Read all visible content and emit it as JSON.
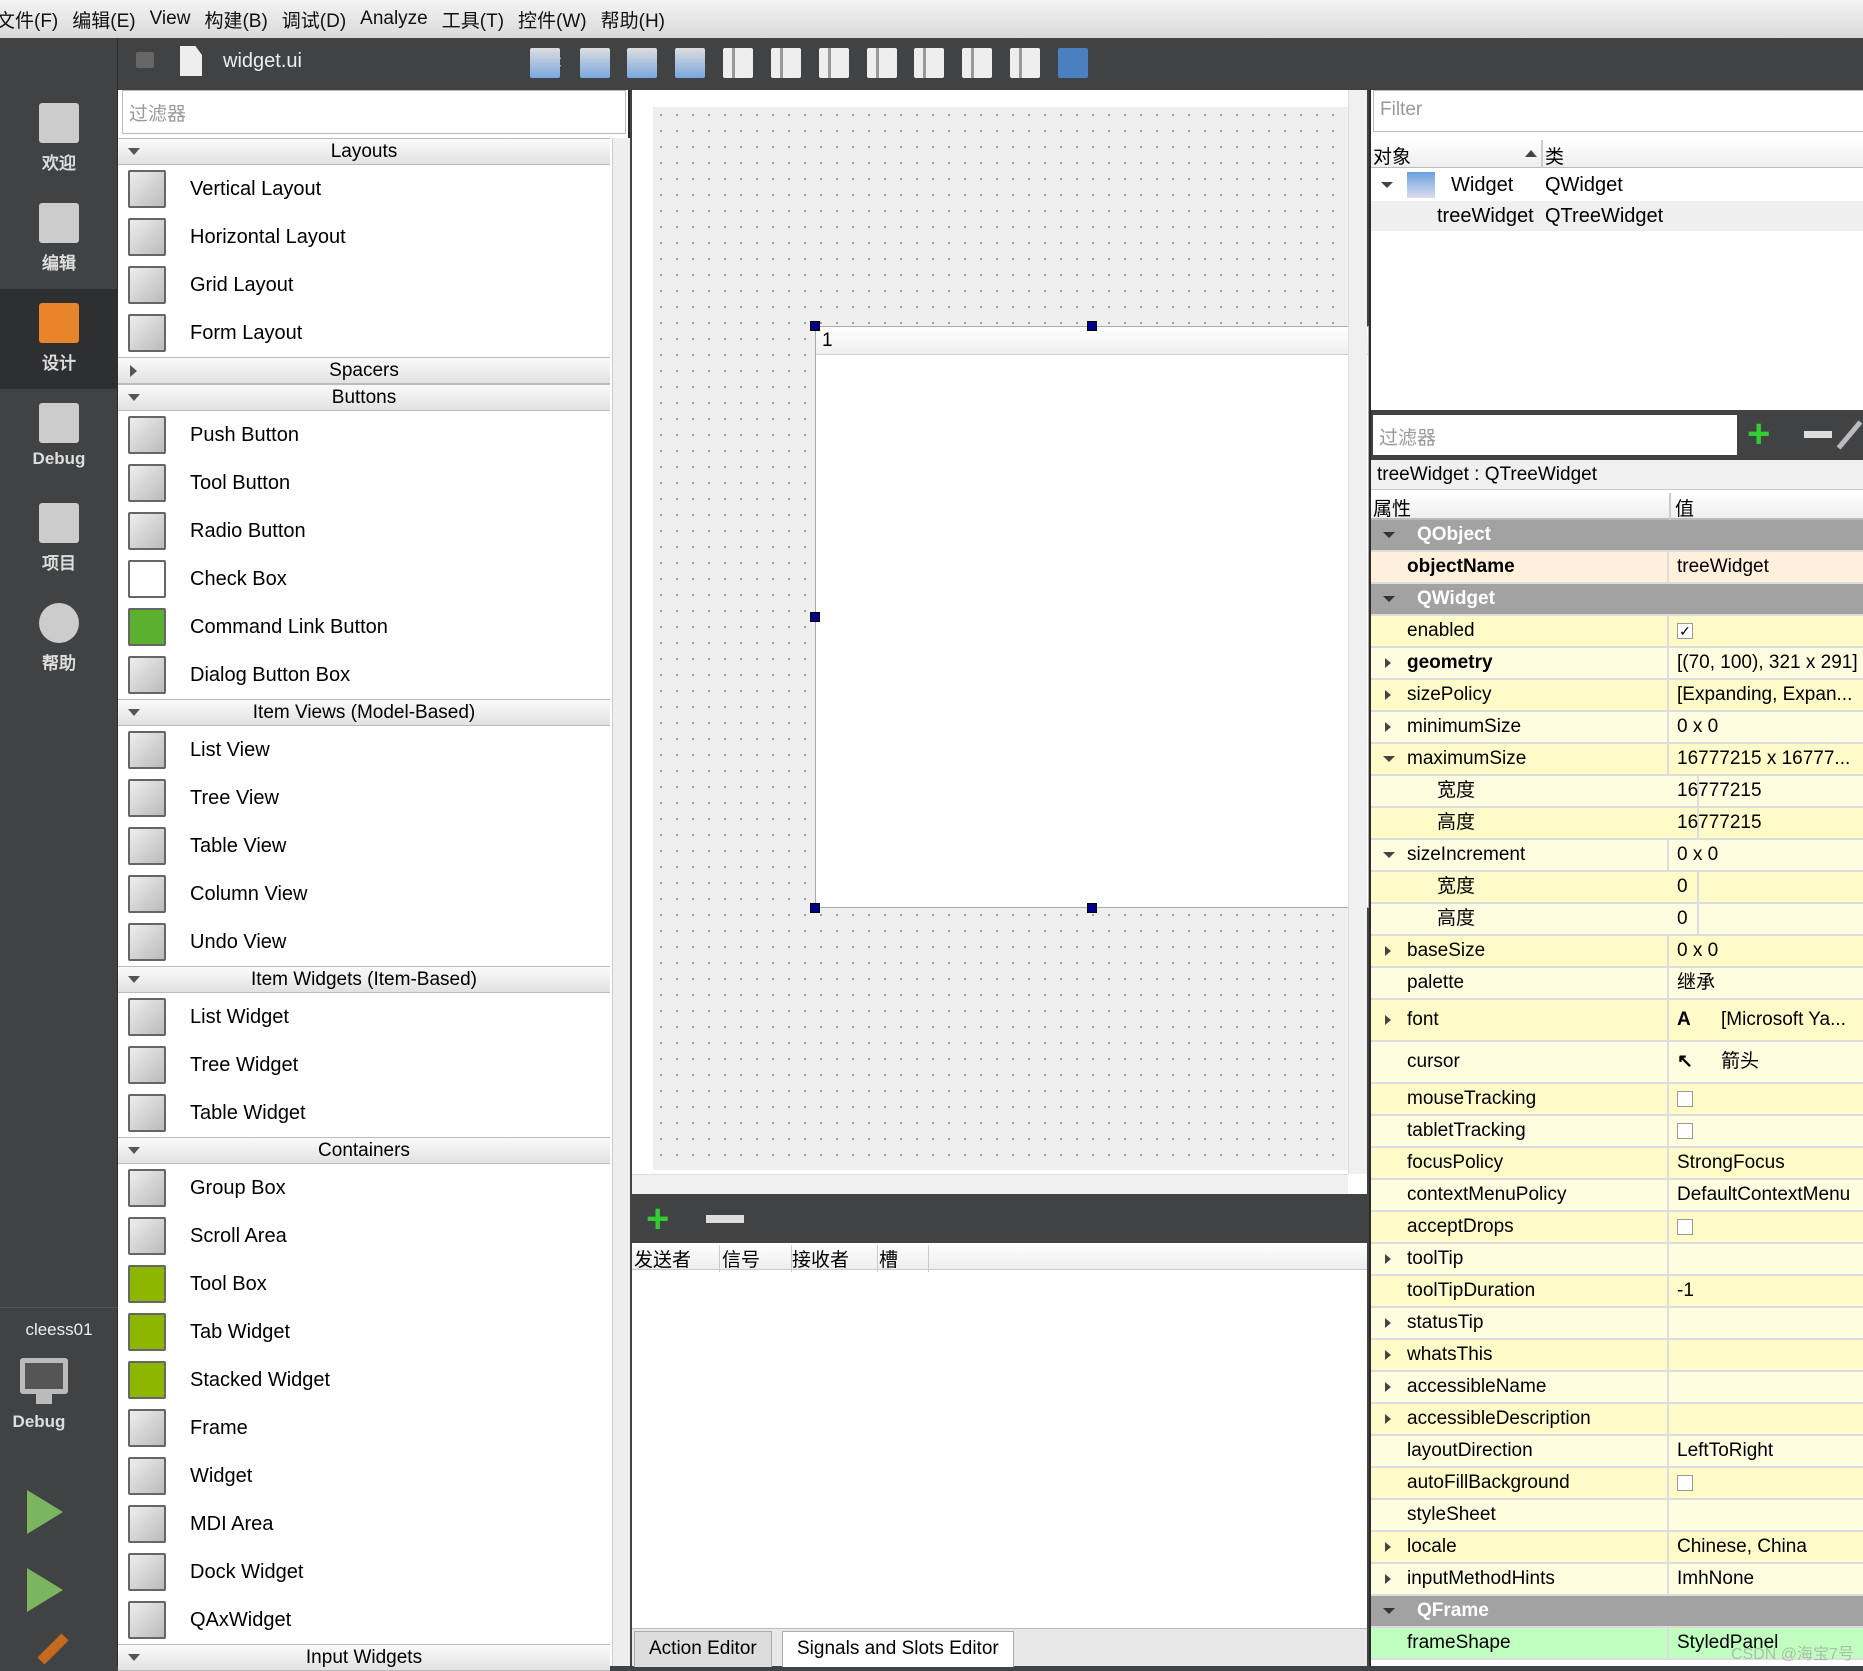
{
  "menu": [
    "文件(F)",
    "编辑(E)",
    "View",
    "构建(B)",
    "调试(D)",
    "Analyze",
    "工具(T)",
    "控件(W)",
    "帮助(H)"
  ],
  "sidebar": {
    "modes": [
      {
        "label": "欢迎",
        "icon": "grid-icon"
      },
      {
        "label": "编辑",
        "icon": "document-icon"
      },
      {
        "label": "设计",
        "icon": "pencil-icon",
        "active": true
      },
      {
        "label": "Debug",
        "icon": "bug-icon"
      },
      {
        "label": "项目",
        "icon": "wrench-icon"
      },
      {
        "label": "帮助",
        "icon": "help-icon"
      }
    ],
    "kit": {
      "project": "cleess01",
      "build": "Debug"
    }
  },
  "toolbar": {
    "file": "widget.ui",
    "icons": [
      "edit-widgets-icon",
      "edit-signals-slots-icon",
      "edit-buddies-icon",
      "edit-tab-order-icon",
      "layout-horizontal-icon",
      "layout-vertical-icon",
      "layout-horizontal-splitter-icon",
      "layout-vertical-splitter-icon",
      "layout-form-icon",
      "layout-grid-icon",
      "break-layout-icon",
      "adjust-size-icon"
    ]
  },
  "widget_box": {
    "filter_placeholder": "过滤器",
    "categories": [
      {
        "name": "Layouts",
        "open": true,
        "items": [
          "Vertical Layout",
          "Horizontal Layout",
          "Grid Layout",
          "Form Layout"
        ]
      },
      {
        "name": "Spacers",
        "open": false,
        "items": []
      },
      {
        "name": "Buttons",
        "open": true,
        "items": [
          "Push Button",
          "Tool Button",
          "Radio Button",
          "Check Box",
          "Command Link Button",
          "Dialog Button Box"
        ]
      },
      {
        "name": "Item Views (Model-Based)",
        "open": true,
        "items": [
          "List View",
          "Tree View",
          "Table View",
          "Column View",
          "Undo View"
        ]
      },
      {
        "name": "Item Widgets (Item-Based)",
        "open": true,
        "items": [
          "List Widget",
          "Tree Widget",
          "Table Widget"
        ]
      },
      {
        "name": "Containers",
        "open": true,
        "items": [
          "Group Box",
          "Scroll Area",
          "Tool Box",
          "Tab Widget",
          "Stacked Widget",
          "Frame",
          "Widget",
          "MDI Area",
          "Dock Widget",
          "QAxWidget"
        ]
      },
      {
        "name": "Input Widgets",
        "open": true,
        "items": []
      }
    ]
  },
  "canvas": {
    "tree_header": "1"
  },
  "signals_editor": {
    "columns": [
      "发送者",
      "信号",
      "接收者",
      "槽"
    ],
    "tabs": [
      "Action Editor",
      "Signals and Slots Editor"
    ],
    "active_tab": 1
  },
  "object_inspector": {
    "filter_placeholder": "Filter",
    "columns": [
      "对象",
      "类"
    ],
    "rows": [
      {
        "object": "Widget",
        "class": "QWidget"
      },
      {
        "object": "treeWidget",
        "class": "QTreeWidget"
      }
    ]
  },
  "property_editor": {
    "filter_placeholder": "过滤器",
    "class_line": "treeWidget : QTreeWidget",
    "columns": [
      "属性",
      "值"
    ],
    "rows": [
      {
        "type": "group",
        "name": "QObject"
      },
      {
        "name": "objectName",
        "value": "treeWidget",
        "bold": true,
        "color": "#fff0dc"
      },
      {
        "type": "group",
        "name": "QWidget"
      },
      {
        "name": "enabled",
        "check": true
      },
      {
        "name": "geometry",
        "value": "[(70, 100), 321 x 291]",
        "bold": true,
        "exp": "collapsed"
      },
      {
        "name": "sizePolicy",
        "value": "[Expanding, Expan...",
        "exp": "collapsed"
      },
      {
        "name": "minimumSize",
        "value": "0 x 0",
        "exp": "collapsed"
      },
      {
        "name": "maximumSize",
        "value": "16777215 x 16777...",
        "exp": "expanded"
      },
      {
        "name": "宽度",
        "value": "16777215",
        "sub": true
      },
      {
        "name": "高度",
        "value": "16777215",
        "sub": true
      },
      {
        "name": "sizeIncrement",
        "value": "0 x 0",
        "exp": "expanded"
      },
      {
        "name": "宽度",
        "value": "0",
        "sub": true
      },
      {
        "name": "高度",
        "value": "0",
        "sub": true
      },
      {
        "name": "baseSize",
        "value": "0 x 0",
        "exp": "collapsed"
      },
      {
        "name": "palette",
        "value": "继承"
      },
      {
        "name": "font",
        "value": "[Microsoft Ya...",
        "exp": "collapsed",
        "tall": true,
        "icon": "font-icon"
      },
      {
        "name": "cursor",
        "value": "箭头",
        "tall": true,
        "icon": "arrow-cursor-icon"
      },
      {
        "name": "mouseTracking",
        "check": false
      },
      {
        "name": "tabletTracking",
        "check": false
      },
      {
        "name": "focusPolicy",
        "value": "StrongFocus"
      },
      {
        "name": "contextMenuPolicy",
        "value": "DefaultContextMenu"
      },
      {
        "name": "acceptDrops",
        "check": false
      },
      {
        "name": "toolTip",
        "value": "",
        "exp": "collapsed"
      },
      {
        "name": "toolTipDuration",
        "value": "-1"
      },
      {
        "name": "statusTip",
        "value": "",
        "exp": "collapsed"
      },
      {
        "name": "whatsThis",
        "value": "",
        "exp": "collapsed"
      },
      {
        "name": "accessibleName",
        "value": "",
        "exp": "collapsed"
      },
      {
        "name": "accessibleDescription",
        "value": "",
        "exp": "collapsed"
      },
      {
        "name": "layoutDirection",
        "value": "LeftToRight"
      },
      {
        "name": "autoFillBackground",
        "check": false
      },
      {
        "name": "styleSheet",
        "value": ""
      },
      {
        "name": "locale",
        "value": "Chinese, China",
        "exp": "collapsed"
      },
      {
        "name": "inputMethodHints",
        "value": "ImhNone",
        "exp": "collapsed"
      },
      {
        "type": "group",
        "name": "QFrame"
      },
      {
        "name": "frameShape",
        "value": "StyledPanel",
        "color": "#c0ffc0"
      }
    ]
  },
  "watermark": "CSDN @海宝7号",
  "colors": {
    "group": "#a2a2a2",
    "row_a": "#fffbc8",
    "row_b": "#fffde0",
    "selection_handle": "#00008b",
    "chrome": "#404244"
  }
}
